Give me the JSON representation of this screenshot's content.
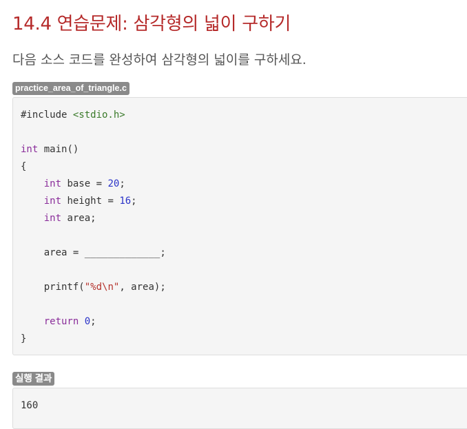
{
  "title": "14.4 연습문제: 삼각형의 넓이 구하기",
  "description": "다음 소스 코드를 완성하여 삼각형의 넓이를 구하세요.",
  "file_label": "practice_area_of_triangle.c",
  "code": {
    "l1": "#include ",
    "l1_header": "<stdio.h>",
    "l3_type": "int",
    "l3_rest": " main()",
    "l4": "{",
    "l5_type": "int",
    "l5_rest": " base = ",
    "l5_num": "20",
    "l5_end": ";",
    "l6_type": "int",
    "l6_rest": " height = ",
    "l6_num": "16",
    "l6_end": ";",
    "l7_type": "int",
    "l7_rest": " area;",
    "l9_text": "area = ",
    "l9_blank": "_____________",
    "l9_end": ";",
    "l11_fn": "printf(",
    "l11_str": "\"%d\\n\"",
    "l11_end": ", area);",
    "l13_kw": "return",
    "l13_num": "0",
    "l13_end": ";",
    "l14": "}"
  },
  "result_label": "실행 결과",
  "output": "160"
}
